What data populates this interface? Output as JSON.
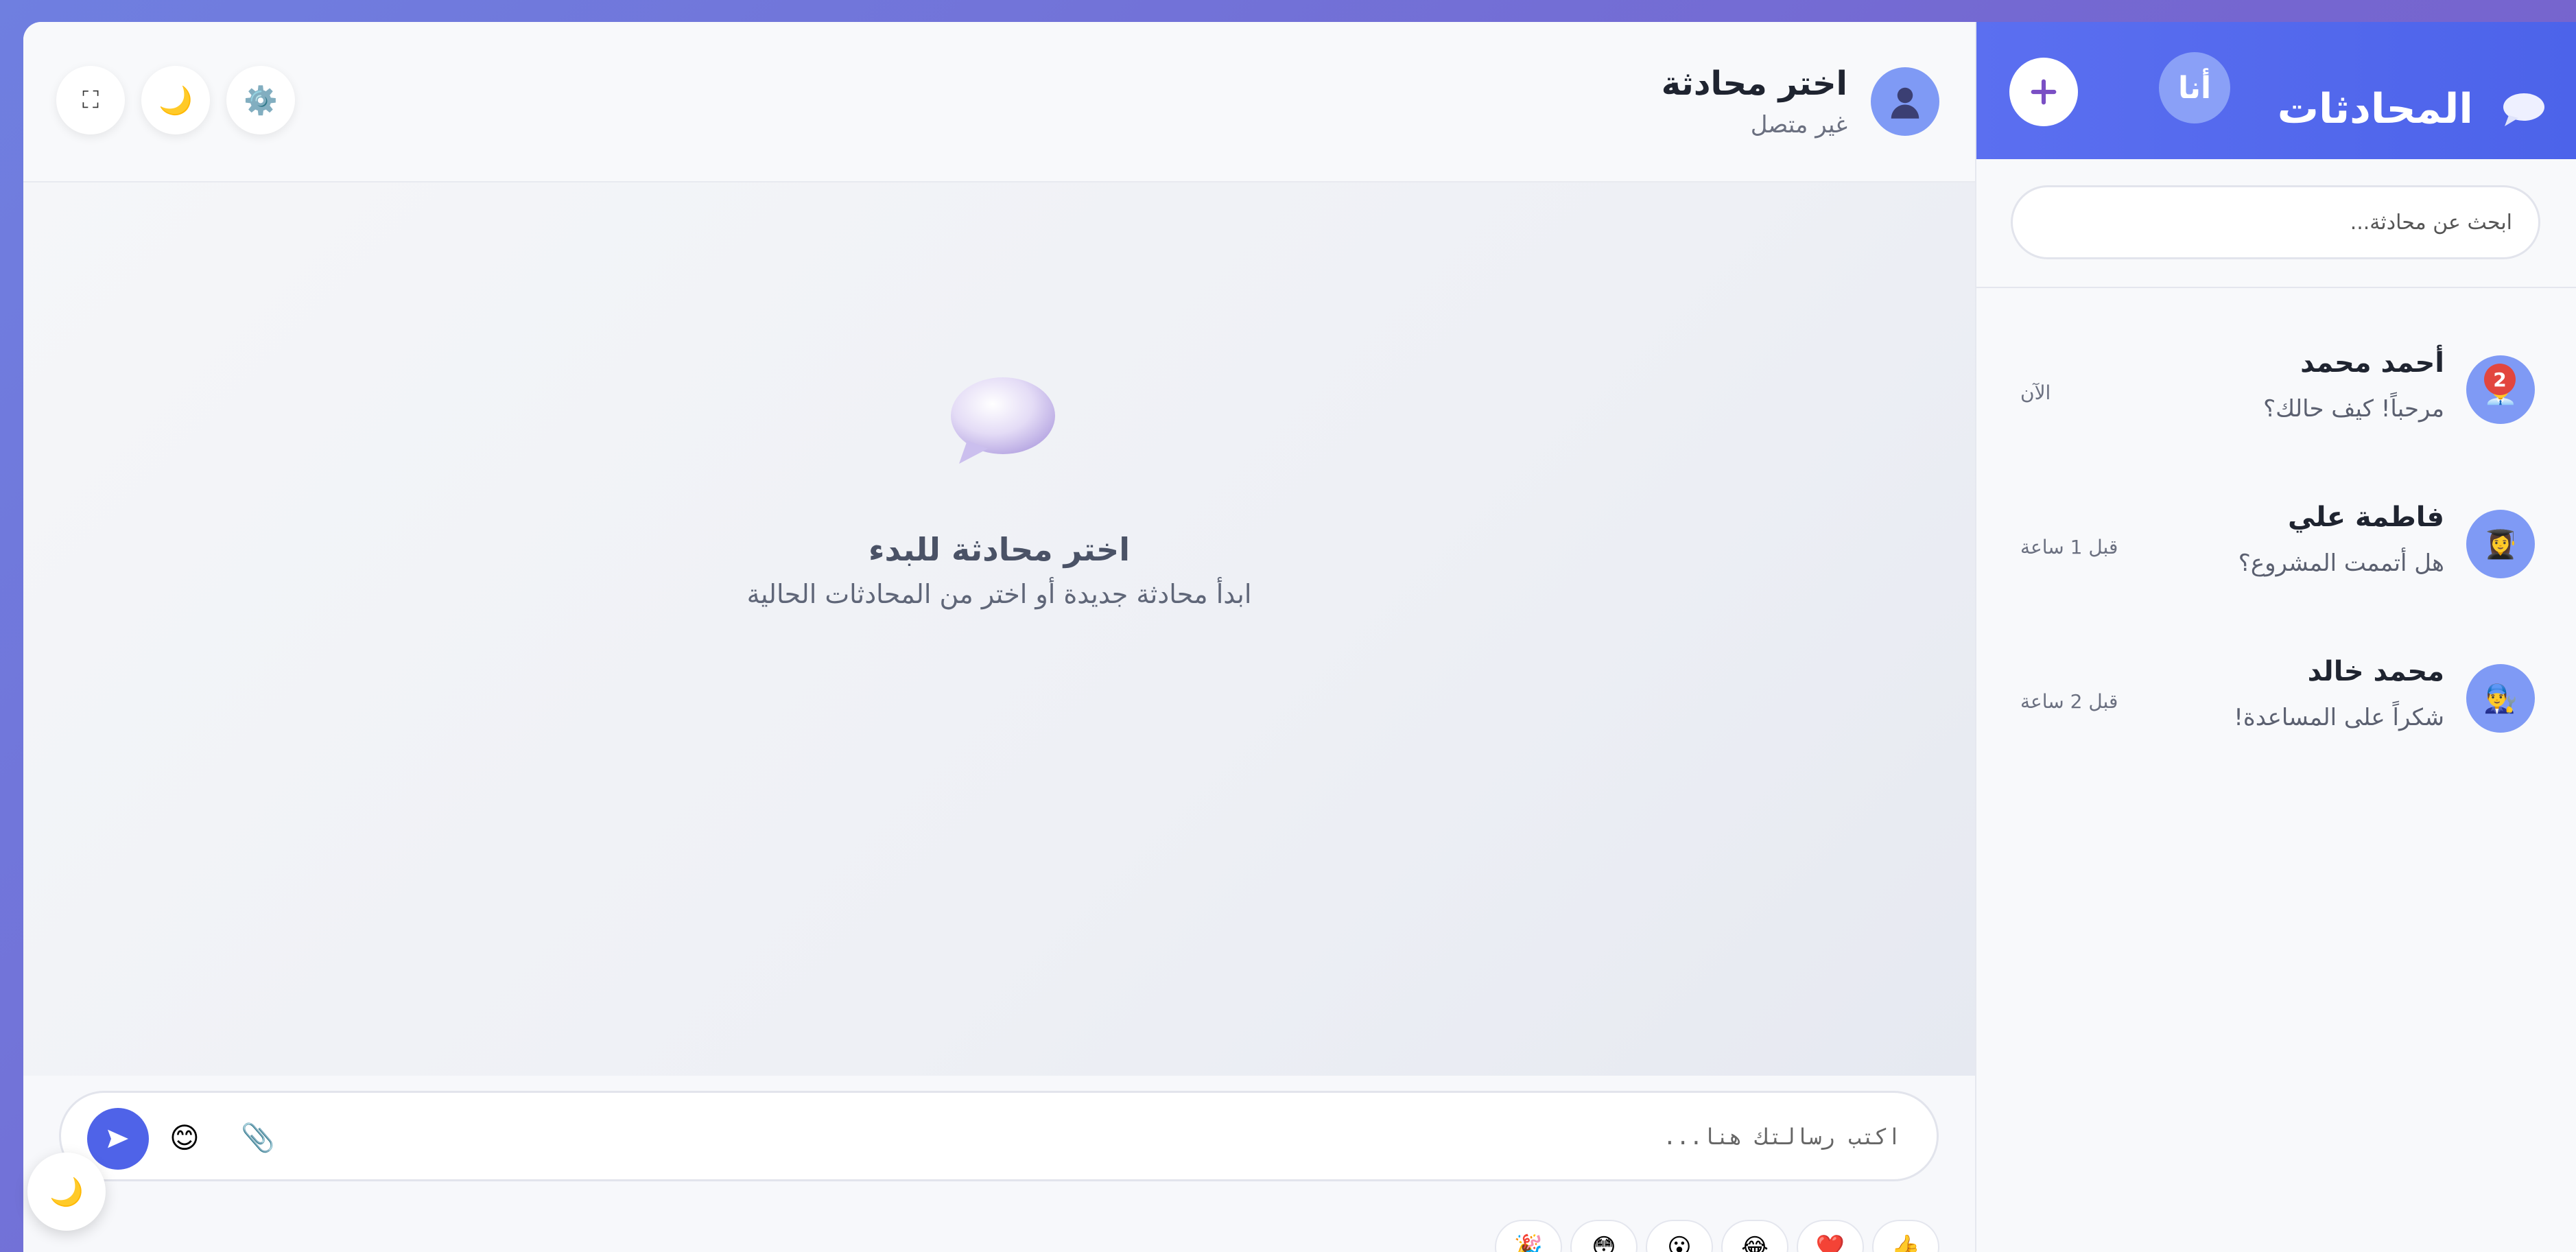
{
  "chat_header": {
    "title": "اختر محادثة",
    "status": "غير متصل",
    "avatar_icon": "user-silhouette-icon",
    "tools": {
      "fullscreen_icon": "⛶",
      "theme_icon": "🌙",
      "settings_icon": "⚙️"
    }
  },
  "empty_state": {
    "icon": "speech-bubble-icon",
    "title": "اختر محادثة للبدء",
    "subtitle": "ابدأ محادثة جديدة أو اختر من المحادثات الحالية"
  },
  "composer": {
    "placeholder": "اكتب رسالتك هنا...",
    "emoji_icon": "😊",
    "attach_icon": "📎",
    "send_icon": "send-icon"
  },
  "quick_reactions": [
    "👍",
    "❤️",
    "😂",
    "😮",
    "😳",
    "🎉"
  ],
  "floating_theme_icon": "🌙",
  "sidebar": {
    "title": "المحادثات",
    "me_label": "أنا",
    "new_chat_icon": "plus-icon",
    "search_placeholder": "ابحث عن محادثة...",
    "chats": [
      {
        "name": "أحمد محمد",
        "preview": "مرحباً! كيف حالك؟",
        "time": "الآن",
        "unread": "2",
        "avatar": "👨‍💼"
      },
      {
        "name": "فاطمة علي",
        "preview": "هل أتممت المشروع؟",
        "time": "قبل 1 ساعة",
        "avatar": "👩‍🎓"
      },
      {
        "name": "محمد خالد",
        "preview": "شكراً على المساعدة!",
        "time": "قبل 2 ساعة",
        "avatar": "👨‍🔧"
      }
    ]
  },
  "colors": {
    "accent": "#4f63e8",
    "header_gradient": "#5b6ff0",
    "badge": "#e2463e",
    "avatar_bg": "#7f9af5"
  }
}
